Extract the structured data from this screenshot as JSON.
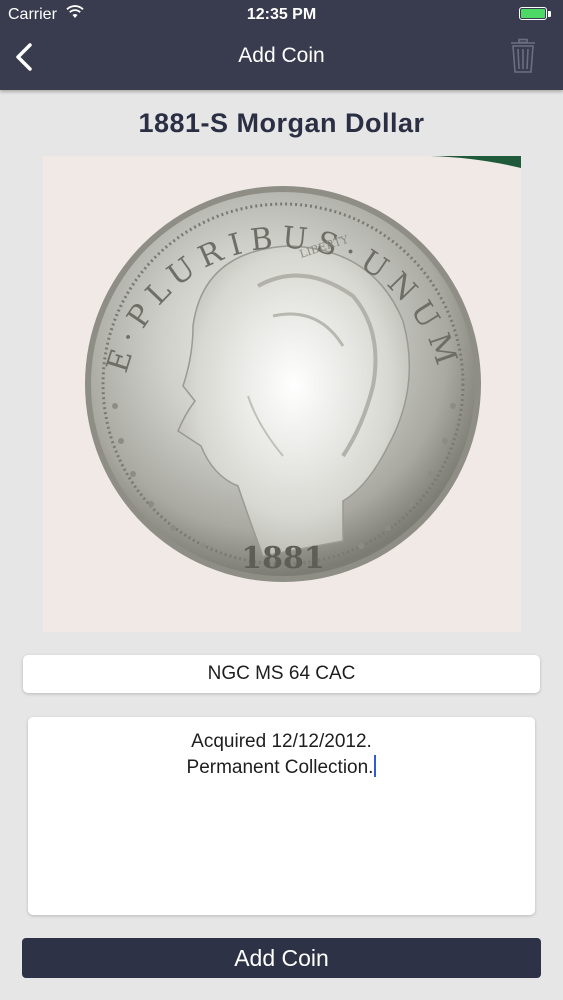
{
  "status_bar": {
    "carrier": "Carrier",
    "time": "12:35 PM",
    "battery_color": "#4cd964"
  },
  "nav": {
    "title": "Add Coin",
    "back_icon": "chevron-left-icon",
    "trash_icon": "trash-icon"
  },
  "coin": {
    "title": "1881-S Morgan Dollar",
    "image_alt": "Morgan dollar obverse",
    "legend": "E·PLURIBUS·UNUM",
    "liberty": "LIBERTY",
    "date": "1881",
    "grade": "NGC MS 64 CAC",
    "notes_line1": "Acquired 12/12/2012.",
    "notes_line2": "Permanent Collection."
  },
  "actions": {
    "add_label": "Add Coin"
  },
  "colors": {
    "nav_bg": "#383c4e",
    "button_bg": "#2e3246",
    "title_color": "#2b2f44",
    "page_bg": "#e6e6e6"
  }
}
